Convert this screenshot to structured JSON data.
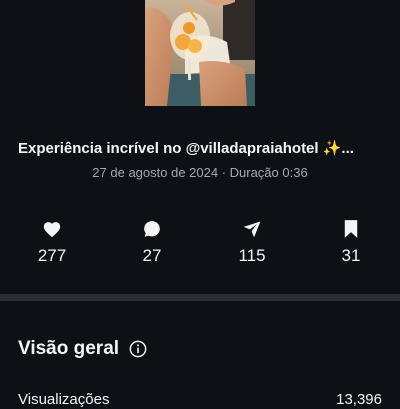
{
  "post": {
    "caption": "Experiência incrível no @villadapraiahotel ✨...",
    "meta": "27 de agosto de 2024 · Duração 0:36",
    "thumbnail": "woman-holding-drink-photo"
  },
  "stats": {
    "likes": "277",
    "comments": "27",
    "shares": "115",
    "saves": "31"
  },
  "overview": {
    "title": "Visão geral",
    "rows": [
      {
        "label": "Visualizações",
        "value": "13,396"
      }
    ]
  },
  "colors": {
    "background": "#0d1014",
    "text": "#f5f5f5",
    "secondary_text": "#a8a8a8",
    "divider": "#2a2d32"
  },
  "icons": {
    "likes": "heart-icon",
    "comments": "comment-icon",
    "shares": "send-icon",
    "saves": "bookmark-icon",
    "overview_info": "info-icon"
  }
}
